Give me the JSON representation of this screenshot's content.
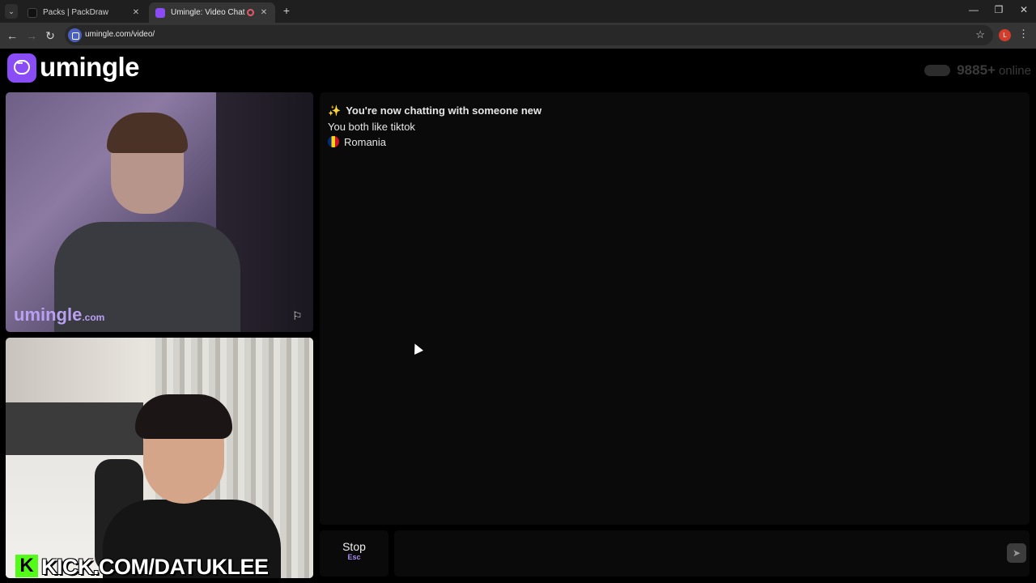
{
  "browser": {
    "tabs": [
      {
        "title": "Packs | PackDraw",
        "active": false
      },
      {
        "title": "Umingle: Video Chat with S",
        "active": true
      }
    ],
    "new_tab_label": "+",
    "url": "umingle.com/video/",
    "profile_initial": "L",
    "window_controls": {
      "minimize": "—",
      "restore": "❐",
      "close": "✕"
    }
  },
  "app": {
    "logo_text": "umingle",
    "online_count": "9885+",
    "online_label": "online"
  },
  "videos": {
    "stranger_watermark": "umingle",
    "stranger_watermark_suffix": ".com",
    "self_overlay": "KICK.COM/DATUKLEE",
    "kick_badge": "K"
  },
  "chat": {
    "messages": [
      {
        "icon": "✨",
        "text": "You're now chatting with someone new"
      },
      {
        "text": "You both like tiktok"
      },
      {
        "text": "Romania"
      }
    ],
    "stop_label": "Stop",
    "stop_key": "Esc",
    "input_placeholder": "",
    "send_icon": "send-icon"
  },
  "colors": {
    "brand": "#8a4cf5",
    "background": "#000000",
    "panel": "#0a0a0a"
  }
}
